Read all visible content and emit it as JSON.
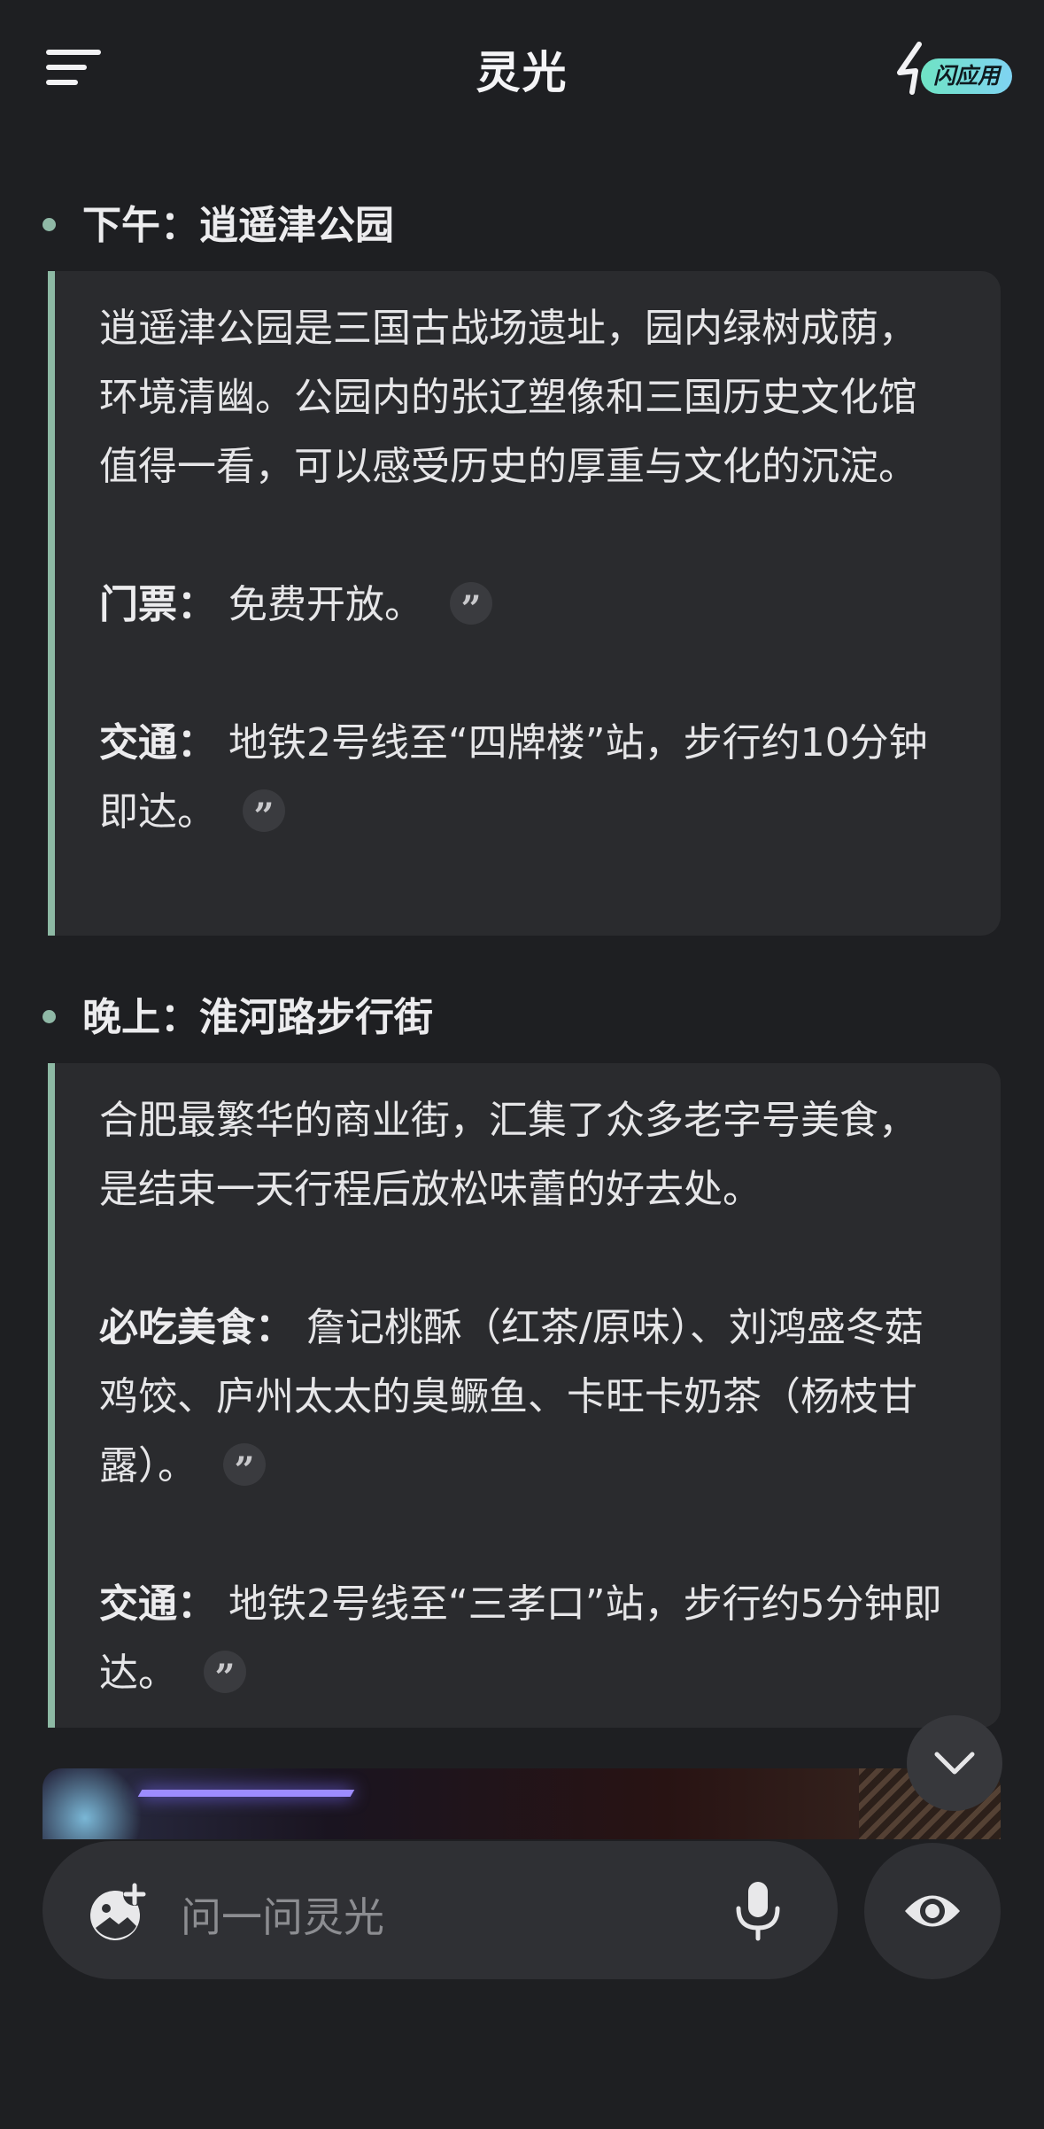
{
  "app": {
    "title": "灵光",
    "flash_badge": "闪应用"
  },
  "sections": [
    {
      "title": "下午：逍遥津公园",
      "description": "逍遥津公园是三国古战场遗址，园内绿树成荫，环境清幽。公园内的张辽塑像和三国历史文化馆值得一看，可以感受历史的厚重与文化的沉淀。",
      "details": [
        {
          "label": "门票：",
          "text": "免费开放。"
        },
        {
          "label": "交通：",
          "text": "地铁2号线至“四牌楼”站，步行约10分钟即达。"
        }
      ]
    },
    {
      "title": "晚上：淮河路步行街",
      "description": "合肥最繁华的商业街，汇集了众多老字号美食，是结束一天行程后放松味蕾的好去处。",
      "details": [
        {
          "label": "必吃美食：",
          "text": "詹记桃酥（红茶/原味）、刘鸿盛冬菇鸡饺、庐州太太的臭鳜鱼、卡旺卡奶茶（杨枝甘露）。"
        },
        {
          "label": "交通：",
          "text": "地铁2号线至“三孝口”站，步行约5分钟即达。"
        }
      ]
    }
  ],
  "citation_glyph": "”",
  "input": {
    "placeholder": "问一问灵光"
  },
  "icons": {
    "menu": "hamburger-menu-icon",
    "flash_app": "sparkle-icon",
    "citation": "quote-icon",
    "scroll_down": "chevron-down-icon",
    "add_image": "add-image-icon",
    "mic": "microphone-icon",
    "eye": "eye-icon"
  },
  "colors": {
    "background": "#1e1f22",
    "card": "#2a2b2e",
    "accent_bar": "#8db9a4",
    "badge_gradient_start": "#6fe3c4",
    "badge_gradient_end": "#7fd3f2"
  }
}
